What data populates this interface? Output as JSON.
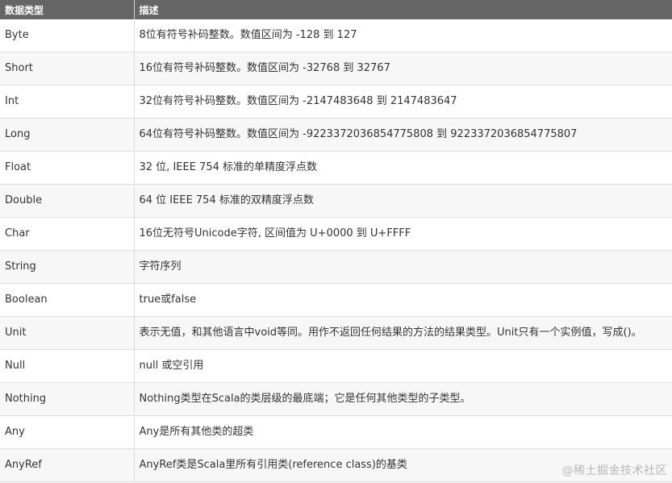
{
  "table": {
    "headers": [
      "数据类型",
      "描述"
    ],
    "rows": [
      {
        "type": "Byte",
        "desc": "8位有符号补码整数。数值区间为 -128 到 127"
      },
      {
        "type": "Short",
        "desc": "16位有符号补码整数。数值区间为 -32768 到 32767"
      },
      {
        "type": "Int",
        "desc": "32位有符号补码整数。数值区间为 -2147483648 到 2147483647"
      },
      {
        "type": "Long",
        "desc": "64位有符号补码整数。数值区间为 -9223372036854775808 到 9223372036854775807"
      },
      {
        "type": "Float",
        "desc": "32 位, IEEE 754 标准的单精度浮点数"
      },
      {
        "type": "Double",
        "desc": "64 位 IEEE 754 标准的双精度浮点数"
      },
      {
        "type": "Char",
        "desc": "16位无符号Unicode字符, 区间值为 U+0000 到 U+FFFF"
      },
      {
        "type": "String",
        "desc": "字符序列"
      },
      {
        "type": "Boolean",
        "desc": "true或false"
      },
      {
        "type": "Unit",
        "desc": "表示无值，和其他语言中void等同。用作不返回任何结果的方法的结果类型。Unit只有一个实例值，写成()。"
      },
      {
        "type": "Null",
        "desc": "null 或空引用"
      },
      {
        "type": "Nothing",
        "desc": "Nothing类型在Scala的类层级的最底端；它是任何其他类型的子类型。"
      },
      {
        "type": "Any",
        "desc": "Any是所有其他类的超类"
      },
      {
        "type": "AnyRef",
        "desc": "AnyRef类是Scala里所有引用类(reference class)的基类"
      }
    ]
  },
  "watermark": "@稀土掘金技术社区"
}
